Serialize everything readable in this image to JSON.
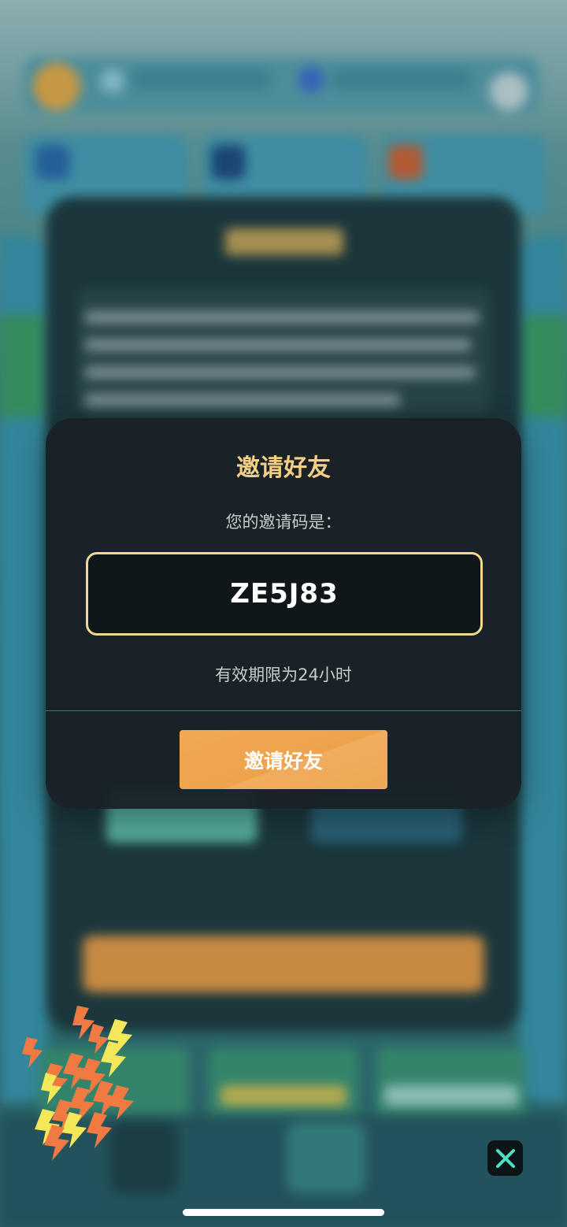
{
  "dialog": {
    "title": "邀请好友",
    "subtitle": "您的邀请码是：",
    "invite_code": "ZE5J83",
    "validity": "有效期限为24小时",
    "invite_button_label": "邀请好友"
  },
  "overlay": {
    "lightning_icon": "lightning-bolt-cluster",
    "close_icon": "close-x"
  },
  "colors": {
    "title_gold": "#f4cf84",
    "code_border": "#f2d98e",
    "button_orange": "#eea24c",
    "dialog_bg": "#182126",
    "close_accent": "#4fe0c4"
  }
}
